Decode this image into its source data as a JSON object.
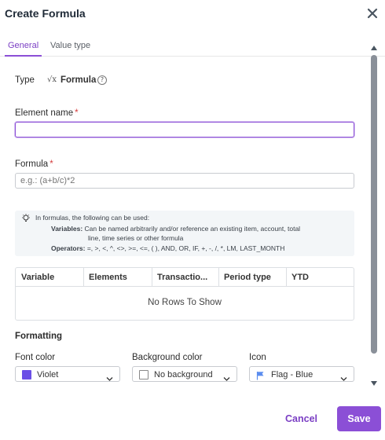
{
  "dialog": {
    "title": "Create Formula",
    "close_icon": "close-icon"
  },
  "tabs": [
    {
      "label": "General",
      "active": true
    },
    {
      "label": "Value type",
      "active": false
    }
  ],
  "type_row": {
    "label": "Type",
    "icon_glyph": "√x",
    "value": "Formula",
    "help_icon": "help-circle-icon",
    "help_glyph": "?"
  },
  "element_name": {
    "label": "Element name",
    "required": "*",
    "value": "",
    "placeholder": ""
  },
  "formula": {
    "label": "Formula",
    "required": "*",
    "value": "",
    "placeholder": "e.g.: (a+b/c)*2"
  },
  "info": {
    "icon": "lightbulb-icon",
    "intro": "In formulas, the following can be used:",
    "variables_key": "Variables:",
    "variables_text_1": "Can be named arbitrarily and/or reference an existing item, account, total",
    "variables_text_2": "line, time series or other formula",
    "operators_key": "Operators:",
    "operators_text": "=, >, <, ^, <>, >=, <=, ( ), AND, OR, IF, +, -, /, *, LM, LAST_MONTH"
  },
  "grid": {
    "columns": [
      "Variable",
      "Elements",
      "Transactio...",
      "Period type",
      "YTD"
    ],
    "empty_text": "No Rows To Show"
  },
  "formatting": {
    "title": "Formatting",
    "font_color": {
      "label": "Font color",
      "value": "Violet",
      "swatch": "#6b4fe6"
    },
    "background_color": {
      "label": "Background color",
      "value": "No background"
    },
    "icon": {
      "label": "Icon",
      "value": "Flag - Blue",
      "icon_name": "flag-icon",
      "color": "#5b8def"
    }
  },
  "footer": {
    "cancel_label": "Cancel",
    "save_label": "Save"
  },
  "colors": {
    "accent": "#8b4fd6",
    "required": "#d43c3c"
  }
}
